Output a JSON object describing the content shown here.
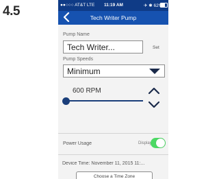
{
  "step": {
    "number": "4.5"
  },
  "status_bar": {
    "carrier": "●●○○○ AT&T  LTE",
    "time": "11:19 AM",
    "right": "✈ ✱ 62%",
    "battery_level": 0.62
  },
  "nav": {
    "title": "Tech Writer Pump"
  },
  "pump_name": {
    "label": "Pump Name",
    "value": "Tech Writer...",
    "set_label": "Set"
  },
  "pump_speeds": {
    "label": "Pump Speeds",
    "selected": "Minimum"
  },
  "rpm": {
    "value": "600 RPM",
    "slider_level": 0.3
  },
  "power_usage": {
    "label": "Power Usage",
    "display_label": "Display",
    "toggle_on": true
  },
  "device_time": {
    "text": "Device Time: November 11, 2015 11:..."
  },
  "timezone": {
    "button_label": "Choose a Time Zone"
  },
  "colors": {
    "status_bar": "#0f3b86",
    "nav_bar": "#1652b0",
    "toggle_on": "#4cd964",
    "slider": "#1a3e7a"
  },
  "icons": [
    "back-icon",
    "chevron-down-icon",
    "chevron-up-icon"
  ]
}
